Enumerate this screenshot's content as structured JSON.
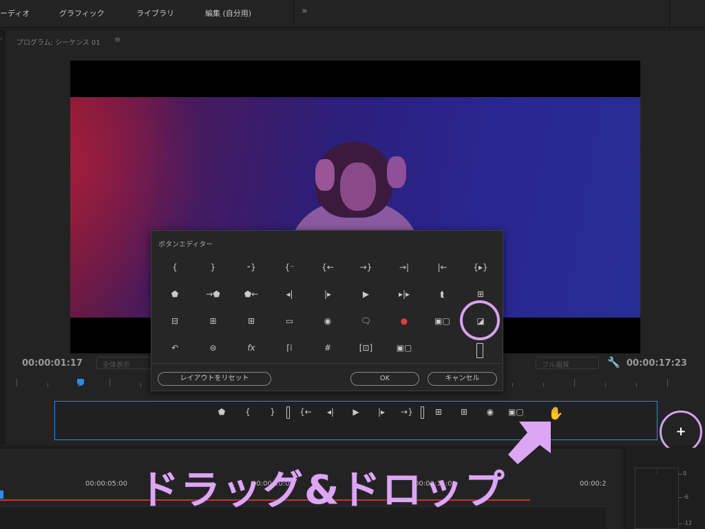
{
  "workspace": {
    "tabs": [
      "ーディオ",
      "グラフィック",
      "ライブラリ",
      "編集 (自分用)"
    ],
    "more_icon": "chevron-double-right-icon"
  },
  "monitor": {
    "title": "プログラム: シーケンス 01",
    "menu_icon": "≡",
    "timecode_current": "00:00:01:17",
    "timecode_duration": "00:00:17:23",
    "fit_dropdown": "全体表示",
    "quality_dropdown": "フル画質",
    "settings_icon": "wrench-icon"
  },
  "button_editor": {
    "title": "ボタンエディター",
    "reset_label": "レイアウトをリセット",
    "ok_label": "OK",
    "cancel_label": "キャンセル",
    "rows": [
      [
        "mark-in-icon",
        "mark-out-icon",
        "mark-clip-icon",
        "go-to-in-icon",
        "go-to-in-out-icon",
        "go-to-out-icon",
        "go-to-next-edit-icon",
        "go-to-prev-edit-icon",
        "play-in-to-out-icon"
      ],
      [
        "add-marker-icon",
        "go-to-next-marker-icon",
        "go-to-prev-marker-icon",
        "step-back-icon",
        "step-forward-icon",
        "play-icon",
        "play-around-icon",
        "export-frame-icon",
        "lift-icon"
      ],
      [
        "extract-icon",
        "insert-icon",
        "overwrite-icon",
        "safe-margins-icon",
        "camera-icon",
        "comment-icon",
        "record-icon",
        "multi-camera-icon",
        "compare-view-icon"
      ],
      [
        "loop-icon",
        "vr-video-icon",
        "fx-icon",
        "trim-icon",
        "grid-icon",
        "proxy-icon",
        "compare-icon",
        "slot-icon"
      ]
    ],
    "glyphs": [
      [
        "{",
        "}",
        "⁃}",
        "{⁻",
        "{←",
        "→}",
        "→|",
        "|←",
        "{▸}"
      ],
      [
        "⬟",
        "→⬟",
        "⬟←",
        "◂|",
        "|▸",
        "▶",
        "▸|▸",
        "⮬",
        "⊞"
      ],
      [
        "⊟",
        "⊞",
        "⊞",
        "▭",
        "◉",
        "🗨",
        "●",
        "▣▢",
        "◪"
      ],
      [
        "↶",
        "⊜",
        "fx",
        "⌈⁞",
        "#",
        "[⊡]",
        "▣▢",
        ""
      ]
    ]
  },
  "button_bar": {
    "items": [
      "add-marker-icon",
      "mark-in-icon",
      "mark-out-icon",
      "separator",
      "go-to-in-icon",
      "step-back-icon",
      "play-icon",
      "step-forward-icon",
      "go-to-out-icon",
      "separator",
      "lift-icon",
      "extract-icon",
      "export-frame-icon",
      "compare-view-icon"
    ],
    "glyphs": [
      "⬟",
      "{",
      "}",
      "",
      "{←",
      "◂|",
      "▶",
      "|▸",
      "→}",
      "",
      "⊞",
      "⊞",
      "◉",
      "▣▢"
    ],
    "cursor": "drag-hand-cursor-icon",
    "add_button_label": "+"
  },
  "timeline": {
    "labels": [
      "00:00:05:00",
      "00:00:10:00",
      "00:00:15:00",
      "00:00:2"
    ]
  },
  "audio_meter": {
    "scale": [
      "0",
      "-6",
      "-12"
    ]
  },
  "annotation": {
    "caption": "ドラッグ&ドロップ",
    "color": "#dca6f5"
  }
}
